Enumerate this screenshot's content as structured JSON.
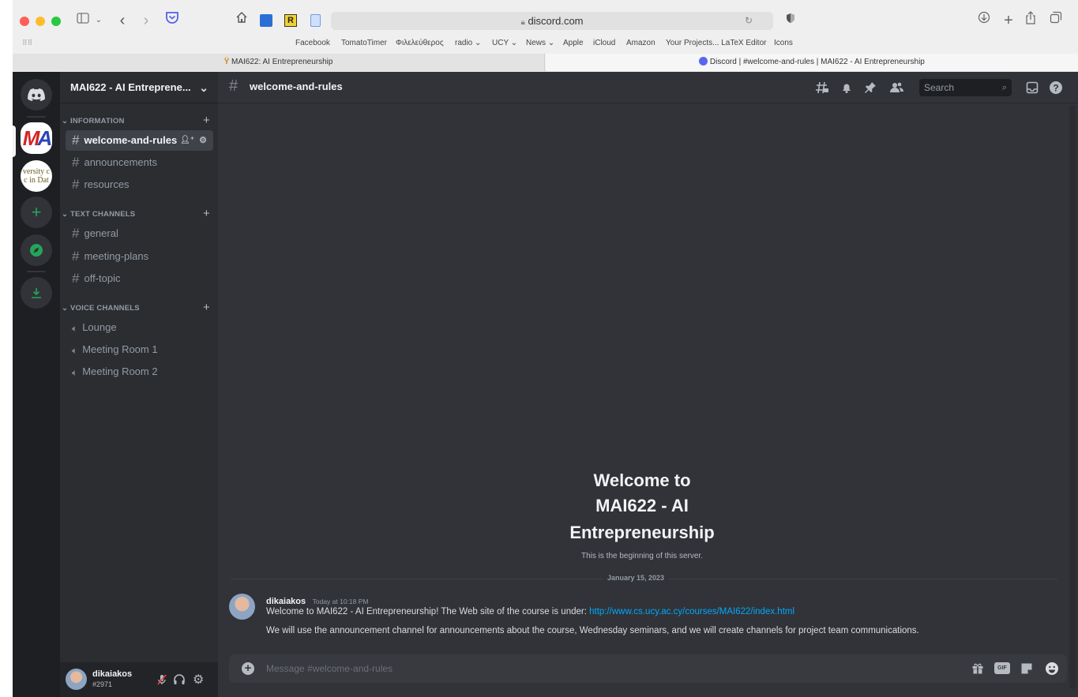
{
  "browser": {
    "url": "discord.com",
    "favorites": [
      "Facebook",
      "TomatoTimer",
      "Φιλελεύθερος",
      "radio ⌄",
      "UCY ⌄",
      "News ⌄",
      "Apple",
      "iCloud",
      "Amazon",
      "Your Projects... LaTeX Editor",
      "Icons"
    ],
    "tabs": [
      {
        "label": "MAI622: AI Entrepreneurship",
        "active": false
      },
      {
        "label": "Discord | #welcome-and-rules | MAI622 - AI Entrepreneurship",
        "active": true
      }
    ]
  },
  "server": {
    "name": "MAI622 - AI Entreprene...",
    "guild_badges": {
      "mai": "MA",
      "university": "versity c\nc in Dat"
    }
  },
  "categories": [
    {
      "name": "INFORMATION",
      "channels": [
        "welcome-and-rules",
        "announcements",
        "resources"
      ]
    },
    {
      "name": "TEXT CHANNELS",
      "channels": [
        "general",
        "meeting-plans",
        "off-topic"
      ]
    },
    {
      "name": "VOICE CHANNELS",
      "channels": [
        "Lounge",
        "Meeting Room 1",
        "Meeting Room 2"
      ]
    }
  ],
  "selected_channel": "welcome-and-rules",
  "user": {
    "name": "dikaiakos",
    "tag": "#2971"
  },
  "header": {
    "channel": "welcome-and-rules",
    "search_placeholder": "Search"
  },
  "welcome": {
    "line1": "Welcome to",
    "line2": "MAI622 - AI",
    "line3": "Entrepreneurship",
    "subtitle": "This is the beginning of this server."
  },
  "date_divider": "January 15, 2023",
  "message": {
    "author": "dikaiakos",
    "timestamp": "Today at 10:18 PM",
    "line1_prefix": "Welcome to MAI622 - AI Entrepreneurship! The Web site of the course is under: ",
    "link": "http://www.cs.ucy.ac.cy/courses/MAI622/index.html",
    "line2": "We will use the announcement channel for announcements about the course, Wednesday seminars, and we will create channels for project team communications."
  },
  "composer": {
    "placeholder": "Message #welcome-and-rules",
    "gif_label": "GIF"
  },
  "colors": {
    "blurple": "#5865f2",
    "green": "#23a55a",
    "link": "#00a8fc",
    "bg_main": "#313338",
    "bg_sidebar": "#2b2d31",
    "bg_guilds": "#1e1f22"
  }
}
